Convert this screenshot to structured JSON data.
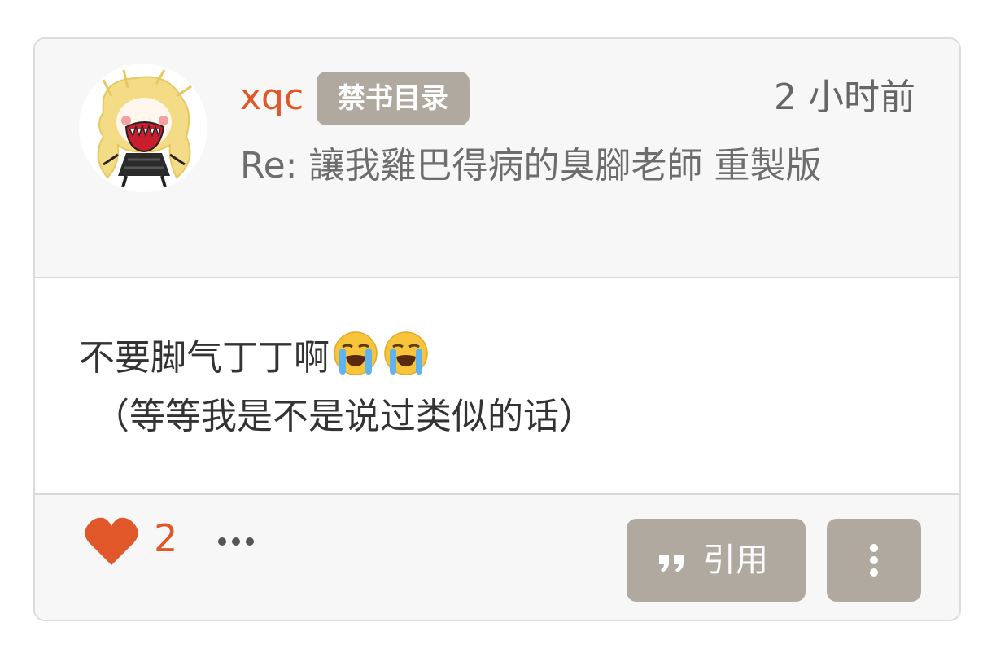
{
  "post": {
    "username": "xqc",
    "group_badge": "禁书目录",
    "timestamp": "2 小时前",
    "reply_title": "Re: 讓我雞巴得病的臭腳老師 重製版",
    "body_line1": "不要脚气丁丁啊",
    "body_line1_emojis": [
      "loudly-crying-face",
      "loudly-crying-face"
    ],
    "body_line2": "（等等我是不是说过类似的话）"
  },
  "footer": {
    "like_count": "2",
    "quote_label": "引用"
  },
  "colors": {
    "accent": "#e0582a",
    "badge": "#b0a9a0",
    "button": "#b0a9a0",
    "muted_text": "#6d6d6d"
  },
  "icons": {
    "like": "heart-icon",
    "more": "ellipsis-icon",
    "quote": "quote-icon",
    "menu": "kebab-menu-icon"
  }
}
